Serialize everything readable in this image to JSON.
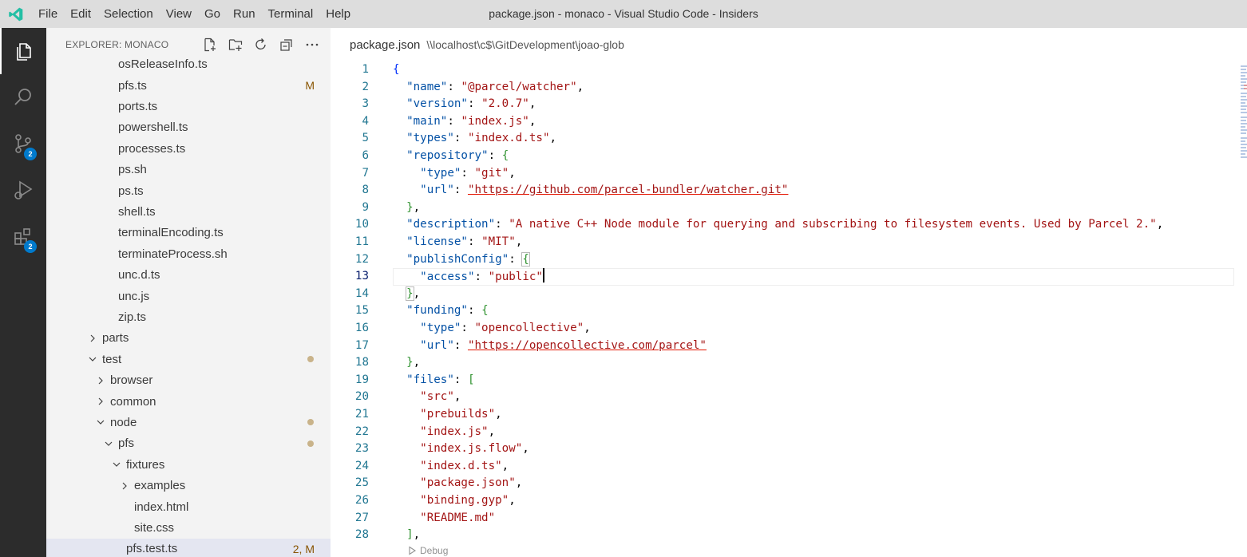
{
  "app": {
    "window_title": "package.json - monaco - Visual Studio Code - Insiders",
    "menu": [
      "File",
      "Edit",
      "Selection",
      "View",
      "Go",
      "Run",
      "Terminal",
      "Help"
    ]
  },
  "activity": {
    "scm_badge": "2",
    "extensions_badge": "2"
  },
  "sidebar": {
    "title": "EXPLORER: MONACO",
    "rows": [
      {
        "label": "osReleaseInfo.ts",
        "indent": 3,
        "type": "file",
        "decor": "",
        "dot": false
      },
      {
        "label": "pfs.ts",
        "indent": 3,
        "type": "file",
        "decor": "M",
        "dot": false
      },
      {
        "label": "ports.ts",
        "indent": 3,
        "type": "file",
        "decor": "",
        "dot": false
      },
      {
        "label": "powershell.ts",
        "indent": 3,
        "type": "file",
        "decor": "",
        "dot": false
      },
      {
        "label": "processes.ts",
        "indent": 3,
        "type": "file",
        "decor": "",
        "dot": false
      },
      {
        "label": "ps.sh",
        "indent": 3,
        "type": "file",
        "decor": "",
        "dot": false
      },
      {
        "label": "ps.ts",
        "indent": 3,
        "type": "file",
        "decor": "",
        "dot": false
      },
      {
        "label": "shell.ts",
        "indent": 3,
        "type": "file",
        "decor": "",
        "dot": false
      },
      {
        "label": "terminalEncoding.ts",
        "indent": 3,
        "type": "file",
        "decor": "",
        "dot": false
      },
      {
        "label": "terminateProcess.sh",
        "indent": 3,
        "type": "file",
        "decor": "",
        "dot": false
      },
      {
        "label": "unc.d.ts",
        "indent": 3,
        "type": "file",
        "decor": "",
        "dot": false
      },
      {
        "label": "unc.js",
        "indent": 3,
        "type": "file",
        "decor": "",
        "dot": false
      },
      {
        "label": "zip.ts",
        "indent": 3,
        "type": "file",
        "decor": "",
        "dot": false
      },
      {
        "label": "parts",
        "indent": 1,
        "type": "folder-closed",
        "decor": "",
        "dot": false
      },
      {
        "label": "test",
        "indent": 1,
        "type": "folder-open",
        "decor": "",
        "dot": true
      },
      {
        "label": "browser",
        "indent": 2,
        "type": "folder-closed",
        "decor": "",
        "dot": false
      },
      {
        "label": "common",
        "indent": 2,
        "type": "folder-closed",
        "decor": "",
        "dot": false
      },
      {
        "label": "node",
        "indent": 2,
        "type": "folder-open",
        "decor": "",
        "dot": true
      },
      {
        "label": "pfs",
        "indent": 3,
        "type": "folder-open",
        "decor": "",
        "dot": true
      },
      {
        "label": "fixtures",
        "indent": 4,
        "type": "folder-open",
        "decor": "",
        "dot": false
      },
      {
        "label": "examples",
        "indent": 5,
        "type": "folder-closed",
        "decor": "",
        "dot": false
      },
      {
        "label": "index.html",
        "indent": 5,
        "type": "file",
        "decor": "",
        "dot": false
      },
      {
        "label": "site.css",
        "indent": 5,
        "type": "file",
        "decor": "",
        "dot": false
      },
      {
        "label": "pfs.test.ts",
        "indent": 4,
        "type": "file",
        "decor": "2, M",
        "dot": false,
        "selected": true
      }
    ]
  },
  "editor": {
    "file_name": "package.json",
    "path": "\\\\localhost\\c$\\GitDevelopment\\joao-glob",
    "current_line": 13,
    "codelens": "Debug",
    "lines": [
      [
        [
          "b1",
          "{"
        ]
      ],
      [
        [
          "p",
          "  "
        ],
        [
          "k",
          "\"name\""
        ],
        [
          "p",
          ": "
        ],
        [
          "s",
          "\"@parcel/watcher\""
        ],
        [
          "p",
          ","
        ]
      ],
      [
        [
          "p",
          "  "
        ],
        [
          "k",
          "\"version\""
        ],
        [
          "p",
          ": "
        ],
        [
          "s",
          "\"2.0.7\""
        ],
        [
          "p",
          ","
        ]
      ],
      [
        [
          "p",
          "  "
        ],
        [
          "k",
          "\"main\""
        ],
        [
          "p",
          ": "
        ],
        [
          "s",
          "\"index.js\""
        ],
        [
          "p",
          ","
        ]
      ],
      [
        [
          "p",
          "  "
        ],
        [
          "k",
          "\"types\""
        ],
        [
          "p",
          ": "
        ],
        [
          "s",
          "\"index.d.ts\""
        ],
        [
          "p",
          ","
        ]
      ],
      [
        [
          "p",
          "  "
        ],
        [
          "k",
          "\"repository\""
        ],
        [
          "p",
          ": "
        ],
        [
          "b2",
          "{"
        ]
      ],
      [
        [
          "p",
          "    "
        ],
        [
          "k",
          "\"type\""
        ],
        [
          "p",
          ": "
        ],
        [
          "s",
          "\"git\""
        ],
        [
          "p",
          ","
        ]
      ],
      [
        [
          "p",
          "    "
        ],
        [
          "k",
          "\"url\""
        ],
        [
          "p",
          ": "
        ],
        [
          "s link",
          "\"https://github.com/parcel-bundler/watcher.git\""
        ]
      ],
      [
        [
          "p",
          "  "
        ],
        [
          "b2",
          "}"
        ],
        [
          "p",
          ","
        ]
      ],
      [
        [
          "p",
          "  "
        ],
        [
          "k",
          "\"description\""
        ],
        [
          "p",
          ": "
        ],
        [
          "s",
          "\"A native C++ Node module for querying and subscribing to filesystem events. Used by Parcel 2.\""
        ],
        [
          "p",
          ","
        ]
      ],
      [
        [
          "p",
          "  "
        ],
        [
          "k",
          "\"license\""
        ],
        [
          "p",
          ": "
        ],
        [
          "s",
          "\"MIT\""
        ],
        [
          "p",
          ","
        ]
      ],
      [
        [
          "p",
          "  "
        ],
        [
          "k",
          "\"publishConfig\""
        ],
        [
          "p",
          ": "
        ],
        [
          "b2 bm",
          "{"
        ]
      ],
      [
        [
          "p",
          "    "
        ],
        [
          "k",
          "\"access\""
        ],
        [
          "p",
          ": "
        ],
        [
          "s",
          "\"public\""
        ],
        [
          "cursor",
          ""
        ]
      ],
      [
        [
          "p",
          "  "
        ],
        [
          "b2 bm",
          "}"
        ],
        [
          "p",
          ","
        ]
      ],
      [
        [
          "p",
          "  "
        ],
        [
          "k",
          "\"funding\""
        ],
        [
          "p",
          ": "
        ],
        [
          "b2",
          "{"
        ]
      ],
      [
        [
          "p",
          "    "
        ],
        [
          "k",
          "\"type\""
        ],
        [
          "p",
          ": "
        ],
        [
          "s",
          "\"opencollective\""
        ],
        [
          "p",
          ","
        ]
      ],
      [
        [
          "p",
          "    "
        ],
        [
          "k",
          "\"url\""
        ],
        [
          "p",
          ": "
        ],
        [
          "s link",
          "\"https://opencollective.com/parcel\""
        ]
      ],
      [
        [
          "p",
          "  "
        ],
        [
          "b2",
          "}"
        ],
        [
          "p",
          ","
        ]
      ],
      [
        [
          "p",
          "  "
        ],
        [
          "k",
          "\"files\""
        ],
        [
          "p",
          ": "
        ],
        [
          "b2",
          "["
        ]
      ],
      [
        [
          "p",
          "    "
        ],
        [
          "s",
          "\"src\""
        ],
        [
          "p",
          ","
        ]
      ],
      [
        [
          "p",
          "    "
        ],
        [
          "s",
          "\"prebuilds\""
        ],
        [
          "p",
          ","
        ]
      ],
      [
        [
          "p",
          "    "
        ],
        [
          "s",
          "\"index.js\""
        ],
        [
          "p",
          ","
        ]
      ],
      [
        [
          "p",
          "    "
        ],
        [
          "s",
          "\"index.js.flow\""
        ],
        [
          "p",
          ","
        ]
      ],
      [
        [
          "p",
          "    "
        ],
        [
          "s",
          "\"index.d.ts\""
        ],
        [
          "p",
          ","
        ]
      ],
      [
        [
          "p",
          "    "
        ],
        [
          "s",
          "\"package.json\""
        ],
        [
          "p",
          ","
        ]
      ],
      [
        [
          "p",
          "    "
        ],
        [
          "s",
          "\"binding.gyp\""
        ],
        [
          "p",
          ","
        ]
      ],
      [
        [
          "p",
          "    "
        ],
        [
          "s",
          "\"README.md\""
        ]
      ],
      [
        [
          "p",
          "  "
        ],
        [
          "b2",
          "]"
        ],
        [
          "p",
          ","
        ]
      ]
    ]
  }
}
